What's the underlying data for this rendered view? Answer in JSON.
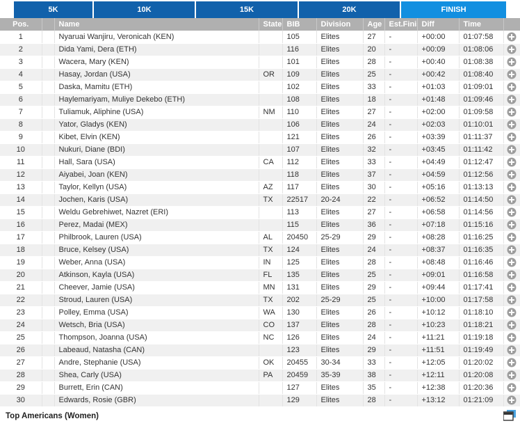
{
  "tabs": [
    {
      "label": "5K",
      "active": false
    },
    {
      "label": "10K",
      "active": false
    },
    {
      "label": "15K",
      "active": false
    },
    {
      "label": "20K",
      "active": false
    },
    {
      "label": "FINISH",
      "active": true
    }
  ],
  "colors": {
    "tab_inactive": "#1161ab",
    "tab_active": "#128fe0",
    "header_bg": "#b0b0b0",
    "row_alt": "#f0f0f0",
    "text": "#333333"
  },
  "table": {
    "columns": [
      {
        "key": "pos",
        "label": "Pos."
      },
      {
        "key": "gap",
        "label": ""
      },
      {
        "key": "name",
        "label": "Name"
      },
      {
        "key": "state",
        "label": "State"
      },
      {
        "key": "bib",
        "label": "BIB"
      },
      {
        "key": "division",
        "label": "Division"
      },
      {
        "key": "age",
        "label": "Age"
      },
      {
        "key": "est",
        "label": "Est.Finish"
      },
      {
        "key": "diff",
        "label": "Diff"
      },
      {
        "key": "time",
        "label": "Time"
      },
      {
        "key": "action",
        "label": ""
      }
    ],
    "rows": [
      {
        "pos": "1",
        "name": "Nyaruai Wanjiru, Veronicah (KEN)",
        "state": "",
        "bib": "105",
        "division": "Elites",
        "age": "27",
        "est": "-",
        "diff": "+00:00",
        "time": "01:07:58"
      },
      {
        "pos": "2",
        "name": "Dida Yami, Dera (ETH)",
        "state": "",
        "bib": "116",
        "division": "Elites",
        "age": "20",
        "est": "-",
        "diff": "+00:09",
        "time": "01:08:06"
      },
      {
        "pos": "3",
        "name": "Wacera, Mary (KEN)",
        "state": "",
        "bib": "101",
        "division": "Elites",
        "age": "28",
        "est": "-",
        "diff": "+00:40",
        "time": "01:08:38"
      },
      {
        "pos": "4",
        "name": "Hasay, Jordan (USA)",
        "state": "OR",
        "bib": "109",
        "division": "Elites",
        "age": "25",
        "est": "-",
        "diff": "+00:42",
        "time": "01:08:40"
      },
      {
        "pos": "5",
        "name": "Daska, Mamitu (ETH)",
        "state": "",
        "bib": "102",
        "division": "Elites",
        "age": "33",
        "est": "-",
        "diff": "+01:03",
        "time": "01:09:01"
      },
      {
        "pos": "6",
        "name": "Haylemariyam, Muliye Dekebo (ETH)",
        "state": "",
        "bib": "108",
        "division": "Elites",
        "age": "18",
        "est": "-",
        "diff": "+01:48",
        "time": "01:09:46"
      },
      {
        "pos": "7",
        "name": "Tuliamuk, Aliphine (USA)",
        "state": "NM",
        "bib": "110",
        "division": "Elites",
        "age": "27",
        "est": "-",
        "diff": "+02:00",
        "time": "01:09:58"
      },
      {
        "pos": "8",
        "name": "Yator, Gladys (KEN)",
        "state": "",
        "bib": "106",
        "division": "Elites",
        "age": "24",
        "est": "-",
        "diff": "+02:03",
        "time": "01:10:01"
      },
      {
        "pos": "9",
        "name": "Kibet, Elvin (KEN)",
        "state": "",
        "bib": "121",
        "division": "Elites",
        "age": "26",
        "est": "-",
        "diff": "+03:39",
        "time": "01:11:37"
      },
      {
        "pos": "10",
        "name": "Nukuri, Diane (BDI)",
        "state": "",
        "bib": "107",
        "division": "Elites",
        "age": "32",
        "est": "-",
        "diff": "+03:45",
        "time": "01:11:42"
      },
      {
        "pos": "11",
        "name": "Hall, Sara (USA)",
        "state": "CA",
        "bib": "112",
        "division": "Elites",
        "age": "33",
        "est": "-",
        "diff": "+04:49",
        "time": "01:12:47"
      },
      {
        "pos": "12",
        "name": "Aiyabei, Joan (KEN)",
        "state": "",
        "bib": "118",
        "division": "Elites",
        "age": "37",
        "est": "-",
        "diff": "+04:59",
        "time": "01:12:56"
      },
      {
        "pos": "13",
        "name": "Taylor, Kellyn (USA)",
        "state": "AZ",
        "bib": "117",
        "division": "Elites",
        "age": "30",
        "est": "-",
        "diff": "+05:16",
        "time": "01:13:13"
      },
      {
        "pos": "14",
        "name": "Jochen, Karis (USA)",
        "state": "TX",
        "bib": "22517",
        "division": "20-24",
        "age": "22",
        "est": "-",
        "diff": "+06:52",
        "time": "01:14:50"
      },
      {
        "pos": "15",
        "name": "Weldu Gebrehiwet, Nazret (ERI)",
        "state": "",
        "bib": "113",
        "division": "Elites",
        "age": "27",
        "est": "-",
        "diff": "+06:58",
        "time": "01:14:56"
      },
      {
        "pos": "16",
        "name": "Perez, Madai (MEX)",
        "state": "",
        "bib": "115",
        "division": "Elites",
        "age": "36",
        "est": "-",
        "diff": "+07:18",
        "time": "01:15:16"
      },
      {
        "pos": "17",
        "name": "Philbrook, Lauren (USA)",
        "state": "AL",
        "bib": "20450",
        "division": "25-29",
        "age": "29",
        "est": "-",
        "diff": "+08:28",
        "time": "01:16:25"
      },
      {
        "pos": "18",
        "name": "Bruce, Kelsey (USA)",
        "state": "TX",
        "bib": "124",
        "division": "Elites",
        "age": "24",
        "est": "-",
        "diff": "+08:37",
        "time": "01:16:35"
      },
      {
        "pos": "19",
        "name": "Weber, Anna (USA)",
        "state": "IN",
        "bib": "125",
        "division": "Elites",
        "age": "28",
        "est": "-",
        "diff": "+08:48",
        "time": "01:16:46"
      },
      {
        "pos": "20",
        "name": "Atkinson, Kayla (USA)",
        "state": "FL",
        "bib": "135",
        "division": "Elites",
        "age": "25",
        "est": "-",
        "diff": "+09:01",
        "time": "01:16:58"
      },
      {
        "pos": "21",
        "name": "Cheever, Jamie (USA)",
        "state": "MN",
        "bib": "131",
        "division": "Elites",
        "age": "29",
        "est": "-",
        "diff": "+09:44",
        "time": "01:17:41"
      },
      {
        "pos": "22",
        "name": "Stroud, Lauren (USA)",
        "state": "TX",
        "bib": "202",
        "division": "25-29",
        "age": "25",
        "est": "-",
        "diff": "+10:00",
        "time": "01:17:58"
      },
      {
        "pos": "23",
        "name": "Polley, Emma (USA)",
        "state": "WA",
        "bib": "130",
        "division": "Elites",
        "age": "26",
        "est": "-",
        "diff": "+10:12",
        "time": "01:18:10"
      },
      {
        "pos": "24",
        "name": "Wetsch, Bria (USA)",
        "state": "CO",
        "bib": "137",
        "division": "Elites",
        "age": "28",
        "est": "-",
        "diff": "+10:23",
        "time": "01:18:21"
      },
      {
        "pos": "25",
        "name": "Thompson, Joanna (USA)",
        "state": "NC",
        "bib": "126",
        "division": "Elites",
        "age": "24",
        "est": "-",
        "diff": "+11:21",
        "time": "01:19:18"
      },
      {
        "pos": "26",
        "name": "Labeaud, Natasha (CAN)",
        "state": "",
        "bib": "123",
        "division": "Elites",
        "age": "29",
        "est": "-",
        "diff": "+11:51",
        "time": "01:19:49"
      },
      {
        "pos": "27",
        "name": "Andre, Stephanie (USA)",
        "state": "OK",
        "bib": "20455",
        "division": "30-34",
        "age": "33",
        "est": "-",
        "diff": "+12:05",
        "time": "01:20:02"
      },
      {
        "pos": "28",
        "name": "Shea, Carly (USA)",
        "state": "PA",
        "bib": "20459",
        "division": "35-39",
        "age": "38",
        "est": "-",
        "diff": "+12:11",
        "time": "01:20:08"
      },
      {
        "pos": "29",
        "name": "Burrett, Erin (CAN)",
        "state": "",
        "bib": "127",
        "division": "Elites",
        "age": "35",
        "est": "-",
        "diff": "+12:38",
        "time": "01:20:36"
      },
      {
        "pos": "30",
        "name": "Edwards, Rosie (GBR)",
        "state": "",
        "bib": "129",
        "division": "Elites",
        "age": "28",
        "est": "-",
        "diff": "+13:12",
        "time": "01:21:09"
      }
    ],
    "row_action_icon": "plus-circle-icon"
  },
  "footer": {
    "title": "Top Americans (Women)",
    "icon": "window-layout-icon"
  }
}
